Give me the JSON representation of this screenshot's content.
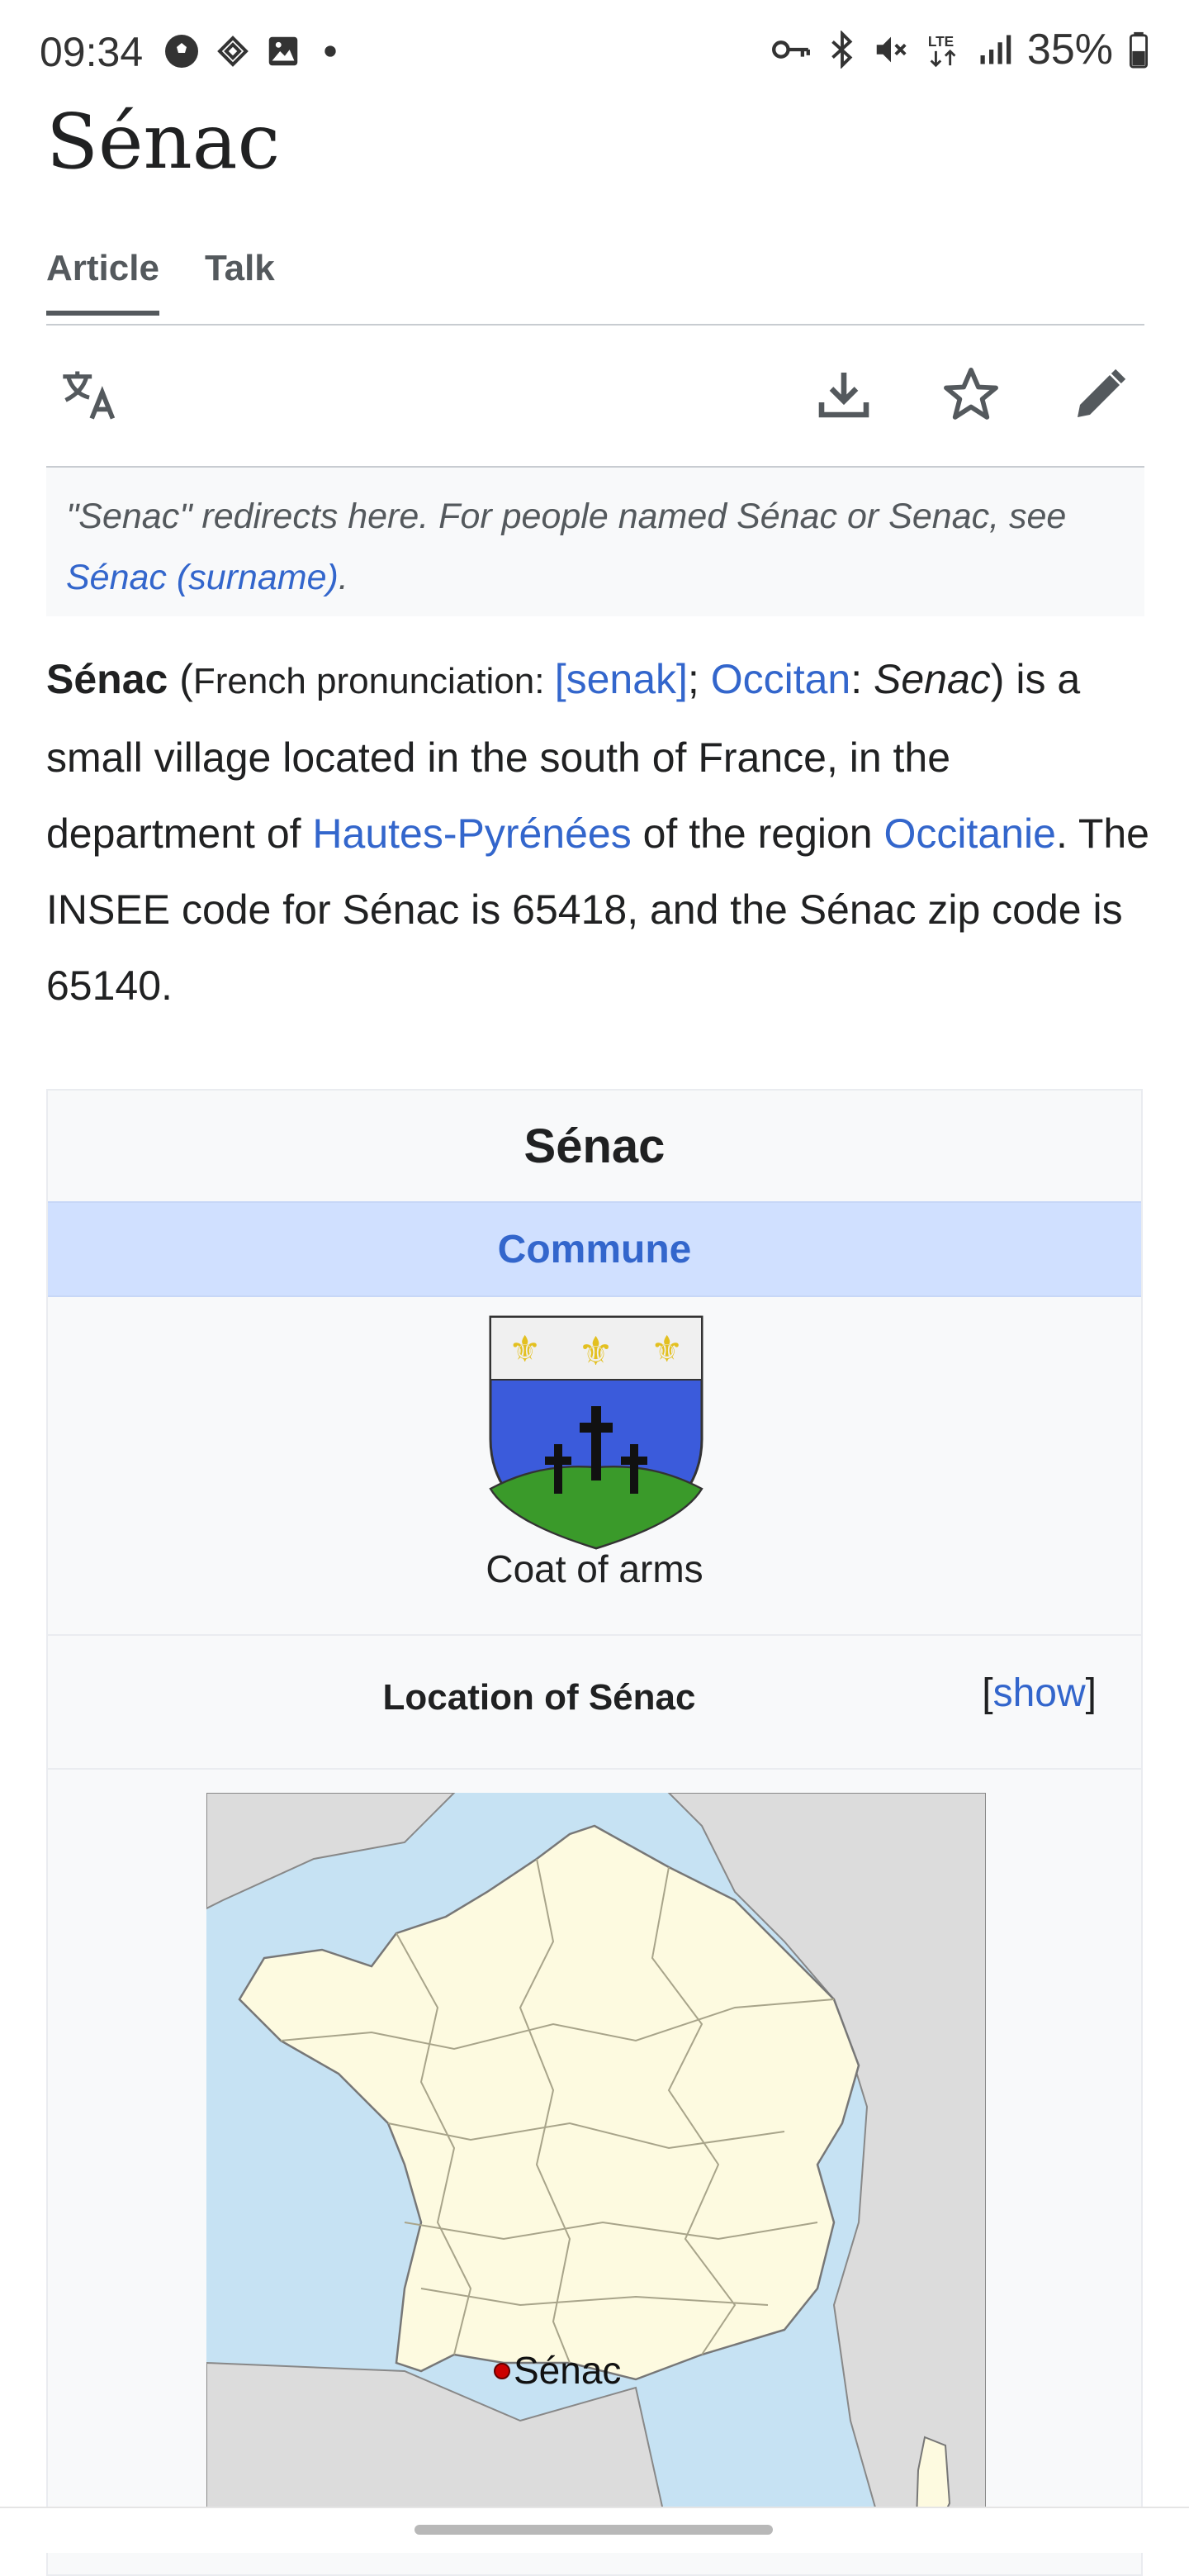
{
  "status_bar": {
    "time": "09:34",
    "left_icons": [
      "soccer-ball-icon",
      "teams-icon",
      "gallery-icon",
      "dot-icon"
    ],
    "right_icons": [
      "vpn-key-icon",
      "bluetooth-icon",
      "mute-icon",
      "lte-icon",
      "signal-icon",
      "battery-icon"
    ],
    "battery": "35%",
    "network": "LTE"
  },
  "page": {
    "title": "Sénac"
  },
  "tabs": [
    {
      "label": "Article",
      "active": true
    },
    {
      "label": "Talk",
      "active": false
    }
  ],
  "toolbar": {
    "icons": [
      "translate-icon",
      "download-icon",
      "star-icon",
      "edit-icon"
    ]
  },
  "hatnote": {
    "text": "\"Senac\" redirects here. For people named Sénac or Senac, see ",
    "link": "Sénac (surname)",
    "end": "."
  },
  "lead": {
    "bold_name": "Sénac",
    "open_paren": " (",
    "pron_label": "French pronunciation: ",
    "ipa": "[senak]",
    "sep1": "; ",
    "occitan_link": "Occitan",
    "colon": ": ",
    "occitan_name": "Senac",
    "rest1": ") is a small village located in the south of France, in the department of ",
    "dept_link": "Hautes-Pyrénées",
    "rest2": " of the region ",
    "region_link": "Occitanie",
    "rest3": ". The INSEE code for Sénac is 65418, and the Sénac zip code is 65140."
  },
  "infobox": {
    "title": "Sénac",
    "type": "Commune",
    "coat_caption": "Coat of arms",
    "location_label": "Location of Sénac",
    "show_open": "[",
    "show_link": "show",
    "show_close": "]",
    "map_marker_label": "Sénac",
    "colors": {
      "header_bg": "#d0e0ff",
      "link": "#3366cc",
      "shield_blue": "#3b5bdb",
      "shield_green": "#3a9a2a"
    }
  }
}
